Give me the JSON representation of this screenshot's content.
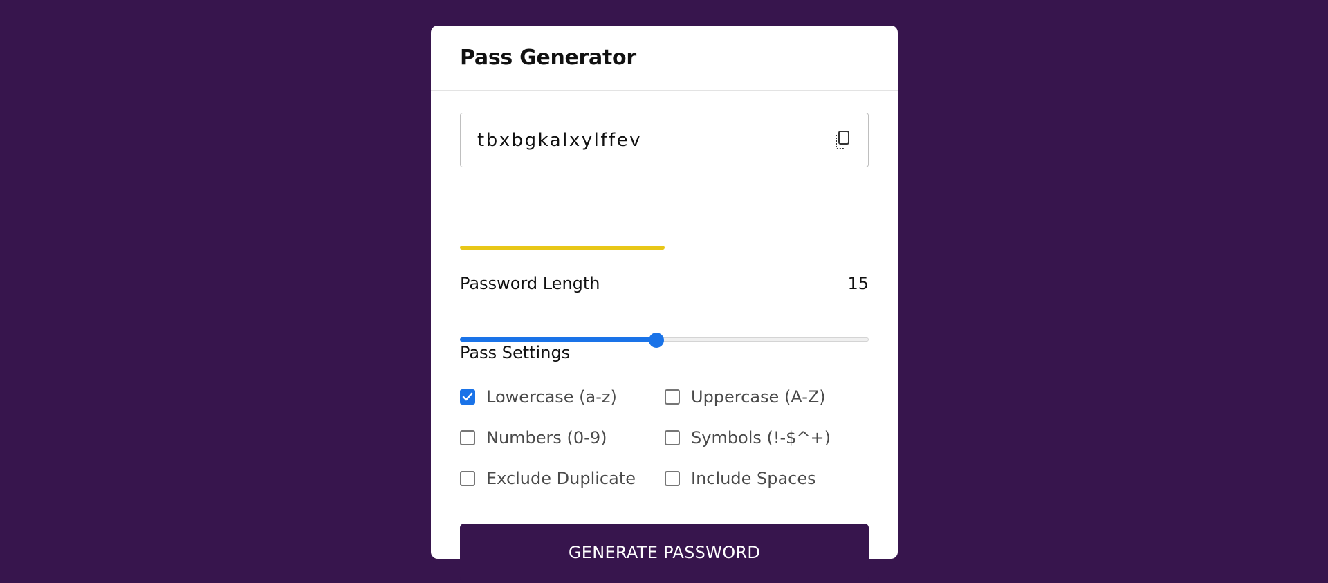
{
  "app": {
    "title": "Pass Generator",
    "background_color": "#37154d",
    "accent_color": "#1a73e8"
  },
  "password": {
    "value": "tbxbgkalxylffev",
    "copy_icon": "copy-icon"
  },
  "strength": {
    "level_fraction": 0.5,
    "color": "#e8c718"
  },
  "length": {
    "label": "Password Length",
    "value": "15",
    "slider_fraction": 0.48
  },
  "settings": {
    "title": "Pass Settings",
    "options": [
      {
        "label": "Lowercase (a-z)",
        "checked": true
      },
      {
        "label": "Uppercase (A-Z)",
        "checked": false
      },
      {
        "label": "Numbers (0-9)",
        "checked": false
      },
      {
        "label": "Symbols (!-$^+)",
        "checked": false
      },
      {
        "label": "Exclude Duplicate",
        "checked": false
      },
      {
        "label": "Include Spaces",
        "checked": false
      }
    ]
  },
  "generate_button": {
    "label": "GENERATE PASSWORD"
  }
}
